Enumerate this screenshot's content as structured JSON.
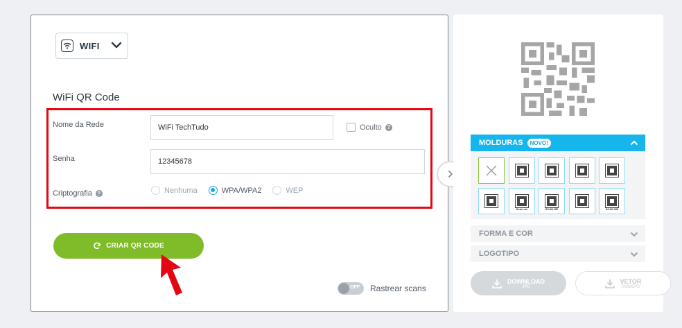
{
  "qr_type": {
    "label": "WIFI"
  },
  "form": {
    "title": "WiFi QR Code",
    "network_label": "Nome da Rede",
    "network_value": "WiFi TechTudo",
    "hidden_label": "Oculto",
    "password_label": "Senha",
    "password_value": "12345678",
    "encryption_label": "Criptografia",
    "encryption_options": [
      "Nenhuma",
      "WPA/WPA2",
      "WEP"
    ],
    "encryption_selected": "WPA/WPA2"
  },
  "create_button": {
    "label": "CRIAR QR CODE"
  },
  "tracking": {
    "toggle_state": "OFF",
    "label": "Rastrear scans"
  },
  "frames": {
    "label": "MOLDURAS",
    "badge": "NOVO!",
    "captions": [
      "SCAN ME",
      "Scan me",
      "SCAN ME"
    ]
  },
  "shape_color": {
    "label": "FORMA E COR"
  },
  "logo": {
    "label": "LOGOTIPO"
  },
  "download": {
    "label": "DOWNLOAD",
    "sub": "JPG"
  },
  "vector": {
    "label": "VETOR",
    "sub": "SVG/EPS"
  },
  "colors": {
    "accent_blue": "#16b5ec",
    "create_green": "#80bc2a",
    "highlight_red": "#e30613"
  },
  "icons": [
    "wifi-icon",
    "chevron-down-icon",
    "help-icon",
    "refresh-icon",
    "chevron-right-icon",
    "chevron-up-icon",
    "close-icon",
    "download-icon"
  ]
}
